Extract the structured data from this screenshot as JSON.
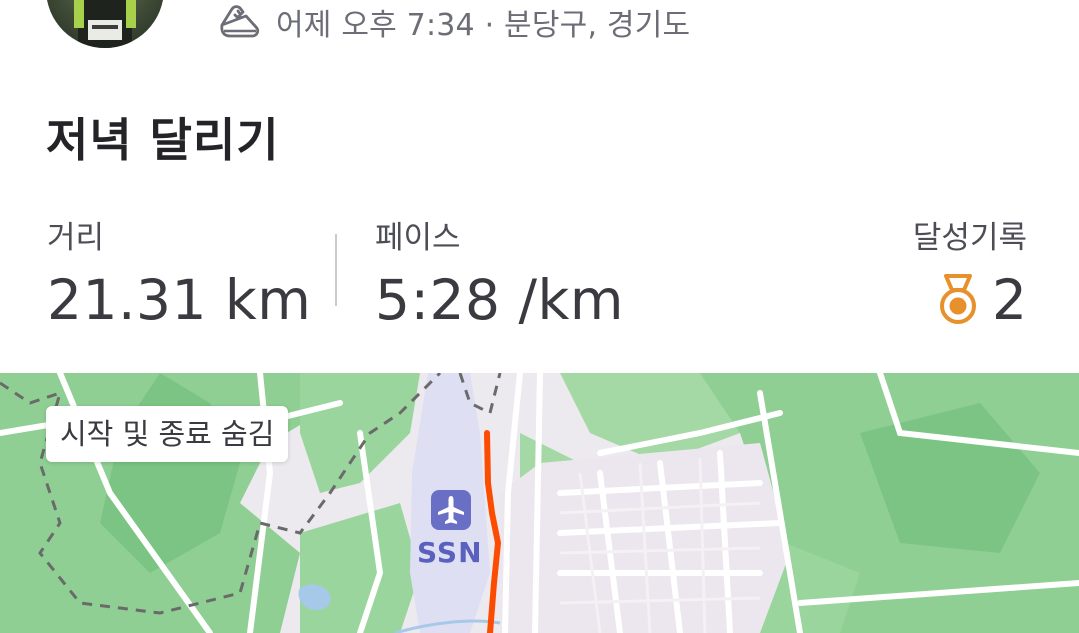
{
  "activity": {
    "meta_text": "어제 오후 7:34 · 분당구, 경기도",
    "title": "저녁 달리기"
  },
  "stats": {
    "distance": {
      "label": "거리",
      "value": "21.31 km"
    },
    "pace": {
      "label": "페이스",
      "value": "5:28 /km"
    },
    "achievements": {
      "label": "달성기록",
      "count": "2"
    }
  },
  "map": {
    "toggle_label": "시작 및 종료 숨김",
    "airport_code": "SSN",
    "route_color": "#fc4c02"
  },
  "colors": {
    "accent": "#fc4c02",
    "medal": "#e8902b",
    "map_green": "#8fcf93",
    "airport": "#6a6fc6"
  },
  "icons": [
    "avatar",
    "running-shoe-icon",
    "medal-icon",
    "airplane-icon"
  ]
}
